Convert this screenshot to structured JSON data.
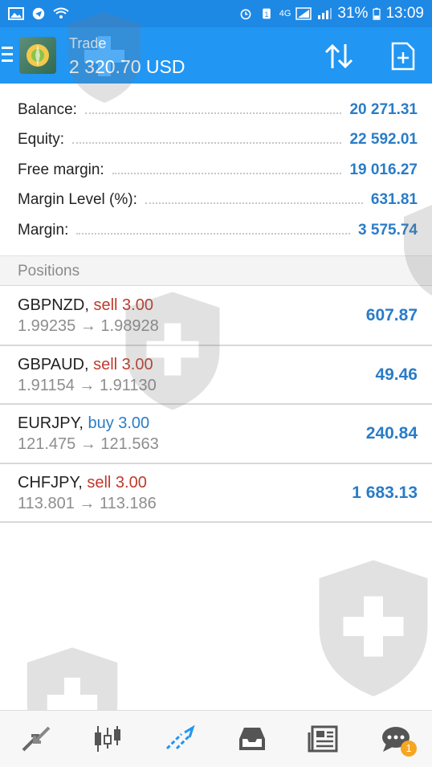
{
  "status_bar": {
    "network": "4G",
    "battery": "31%",
    "time": "13:09"
  },
  "header": {
    "title": "Trade",
    "balance": "2 320.70 USD",
    "sort_icon": "sort-arrows-icon",
    "new_order_icon": "new-order-icon"
  },
  "summary": [
    {
      "label": "Balance:",
      "value": "20 271.31"
    },
    {
      "label": "Equity:",
      "value": "22 592.01"
    },
    {
      "label": "Free margin:",
      "value": "19 016.27"
    },
    {
      "label": "Margin Level (%):",
      "value": "631.81"
    },
    {
      "label": "Margin:",
      "value": "3 575.74"
    }
  ],
  "positions_header": "Positions",
  "positions": [
    {
      "symbol": "GBPNZD,",
      "side": "sell 3.00",
      "side_type": "sell",
      "open": "1.99235",
      "arrow": "→",
      "current": "1.98928",
      "profit": "607.87"
    },
    {
      "symbol": "GBPAUD,",
      "side": "sell 3.00",
      "side_type": "sell",
      "open": "1.91154",
      "arrow": "→",
      "current": "1.91130",
      "profit": "49.46"
    },
    {
      "symbol": "EURJPY,",
      "side": "buy 3.00",
      "side_type": "buy",
      "open": "121.475",
      "arrow": "→",
      "current": "121.563",
      "profit": "240.84"
    },
    {
      "symbol": "CHFJPY,",
      "side": "sell 3.00",
      "side_type": "sell",
      "open": "113.801",
      "arrow": "→",
      "current": "113.186",
      "profit": "1 683.13"
    }
  ],
  "bottom_nav": {
    "items": [
      "quotes-icon",
      "charts-icon",
      "trade-icon",
      "history-icon",
      "news-icon",
      "chat-icon"
    ],
    "chat_badge": "1"
  },
  "colors": {
    "accent": "#2196f3",
    "value_blue": "#2a7cc7",
    "sell_red": "#c0392b"
  }
}
